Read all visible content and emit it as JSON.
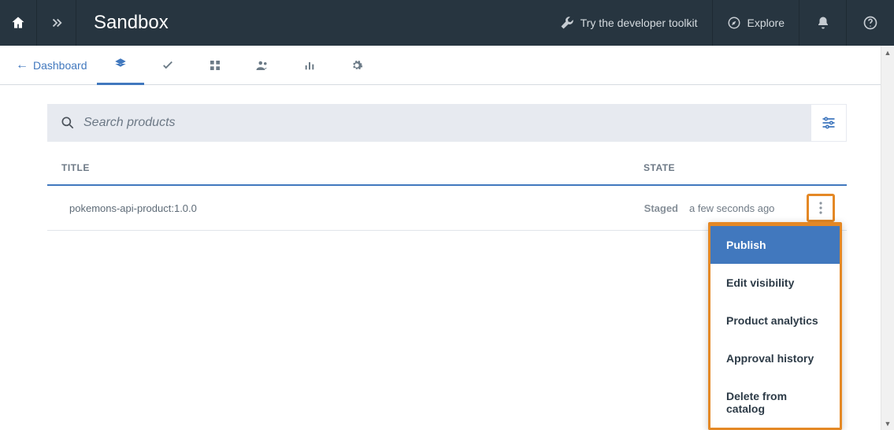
{
  "header": {
    "title": "Sandbox",
    "toolkit_label": "Try the developer toolkit",
    "explore_label": "Explore"
  },
  "subnav": {
    "back_label": "Dashboard"
  },
  "search": {
    "placeholder": "Search products"
  },
  "table": {
    "col_title": "TITLE",
    "col_state": "STATE",
    "rows": [
      {
        "title": "pokemons-api-product:1.0.0",
        "state": "Staged",
        "time": "a few seconds ago"
      }
    ]
  },
  "menu": {
    "items": [
      {
        "label": "Publish",
        "selected": true
      },
      {
        "label": "Edit visibility",
        "selected": false
      },
      {
        "label": "Product analytics",
        "selected": false
      },
      {
        "label": "Approval history",
        "selected": false
      },
      {
        "label": "Delete from catalog",
        "selected": false
      }
    ]
  }
}
